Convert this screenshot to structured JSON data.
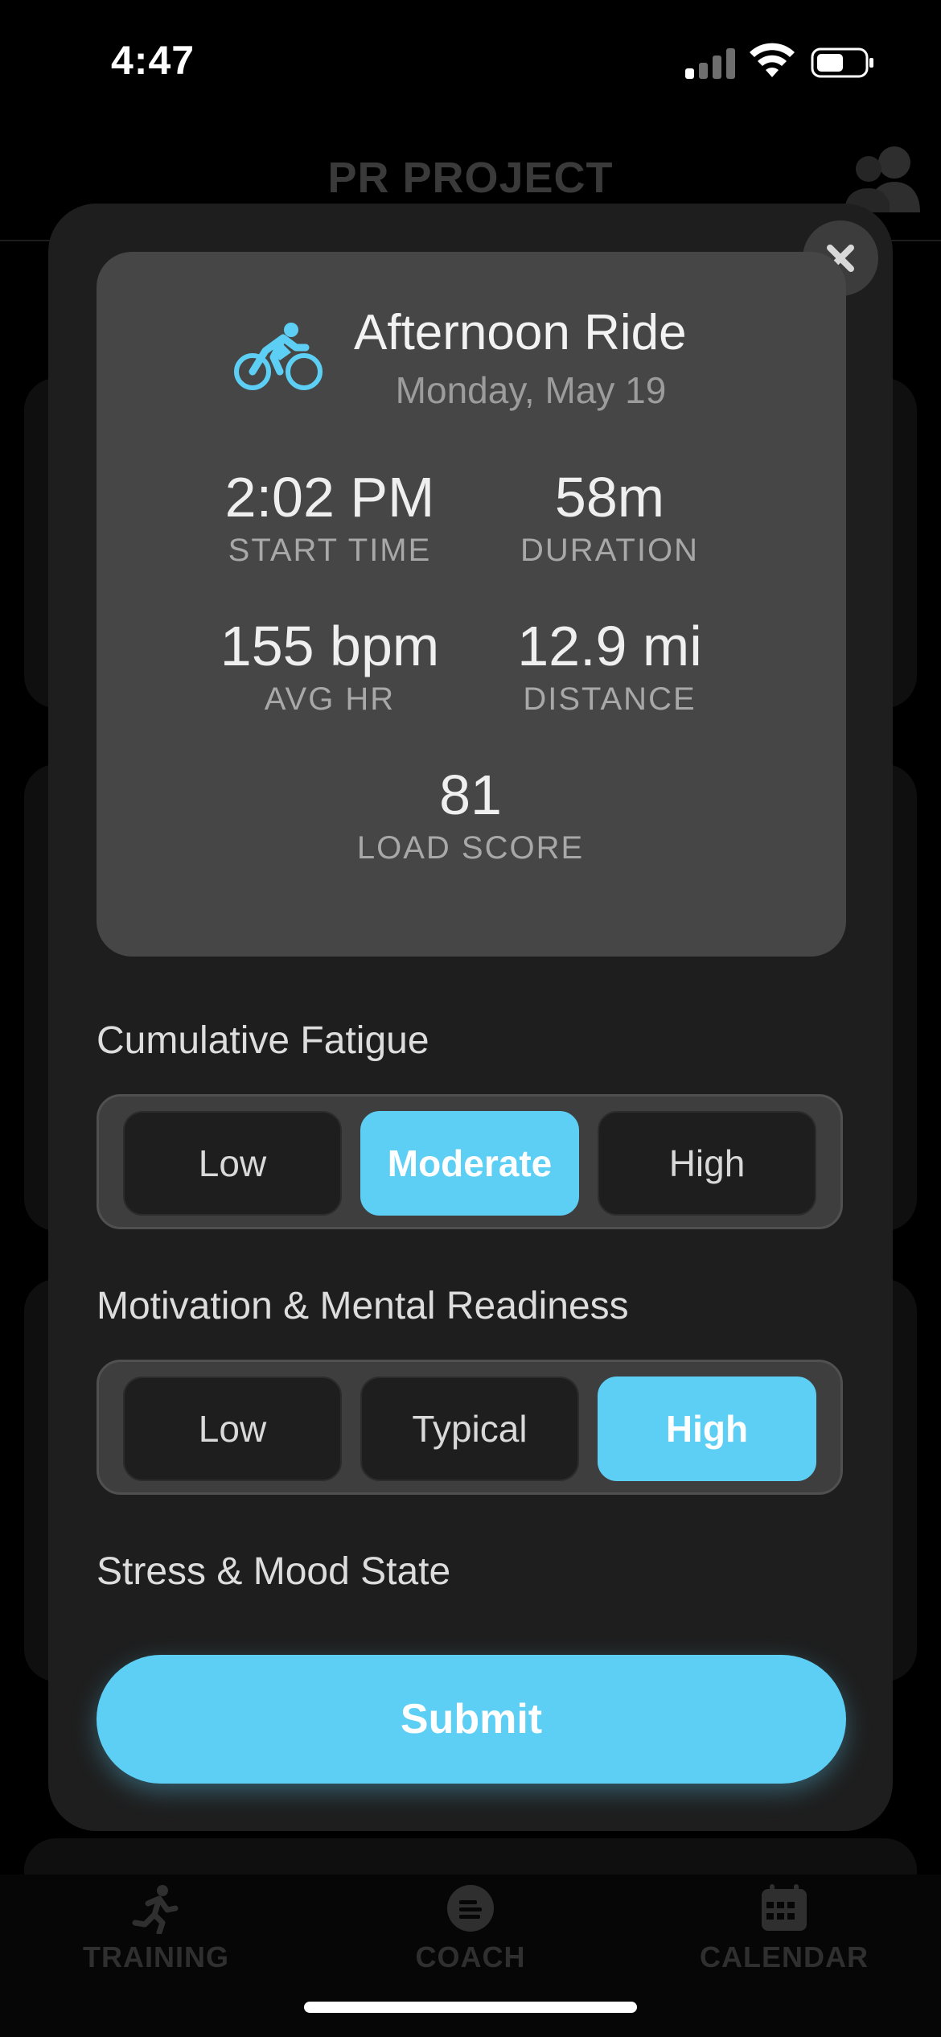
{
  "status_bar": {
    "time": "4:47"
  },
  "app": {
    "title": "PR PROJECT"
  },
  "tabs": [
    {
      "label": "TRAINING",
      "icon": "running-person-icon"
    },
    {
      "label": "COACH",
      "icon": "chat-bubble-icon"
    },
    {
      "label": "CALENDAR",
      "icon": "calendar-icon"
    }
  ],
  "modal": {
    "activity": {
      "icon": "bicycle-icon",
      "title": "Afternoon Ride",
      "date": "Monday, May 19"
    },
    "stats": {
      "start_time": {
        "value": "2:02 PM",
        "label": "START TIME"
      },
      "duration": {
        "value": "58m",
        "label": "DURATION"
      },
      "avg_hr": {
        "value": "155 bpm",
        "label": "AVG HR"
      },
      "distance": {
        "value": "12.9 mi",
        "label": "DISTANCE"
      },
      "load_score": {
        "value": "81",
        "label": "LOAD SCORE"
      }
    },
    "fatigue": {
      "label": "Cumulative Fatigue",
      "options": [
        "Low",
        "Moderate",
        "High"
      ],
      "selected": "Moderate"
    },
    "motivation": {
      "label": "Motivation & Mental Readiness",
      "options": [
        "Low",
        "Typical",
        "High"
      ],
      "selected": "High"
    },
    "stress": {
      "label": "Stress & Mood State"
    },
    "submit_label": "Submit"
  },
  "colors": {
    "accent": "#5dcff5",
    "modal_bg": "#1e1e1e",
    "card_bg": "#464646"
  }
}
